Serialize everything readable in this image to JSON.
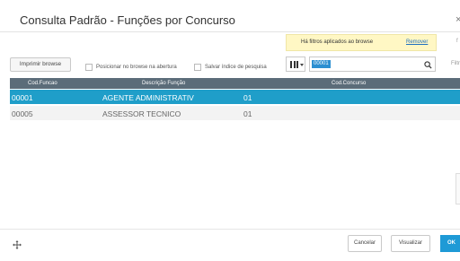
{
  "window": {
    "title": "Consulta Padrão - Funções por Concurso",
    "close_glyph": "×"
  },
  "filter_banner": {
    "text": "Há filtros aplicados ao browse",
    "remove_label": "Remover",
    "clipped_right": "f"
  },
  "toolbar": {
    "print_label": "Imprimir browse",
    "position_label": "Posicionar no browse na abertura",
    "save_index_label": "Salvar índice de pesquisa",
    "search_value": "00001",
    "clipped_right": "Filtr"
  },
  "table": {
    "headers": [
      "Cod.Funcao",
      "Descrição Função",
      "Cod.Concurso"
    ],
    "rows": [
      {
        "cod_funcao": "00001",
        "descricao": "AGENTE ADMINISTRATIV",
        "cod_concurso": "01",
        "selected": true
      },
      {
        "cod_funcao": "00005",
        "descricao": "ASSESSOR TECNICO",
        "cod_concurso": "01",
        "selected": false
      }
    ]
  },
  "footer": {
    "cancel_label": "Cancelar",
    "view_label": "Visualizar",
    "ok_label": "OK"
  },
  "colors": {
    "header_bg": "#5b6c79",
    "selected_row": "#1f9ec9",
    "ok_button": "#1e9ad6",
    "banner_bg": "#fff7c4"
  },
  "icons": [
    "view-toggle-icon",
    "search-icon",
    "move-icon",
    "close-icon"
  ]
}
